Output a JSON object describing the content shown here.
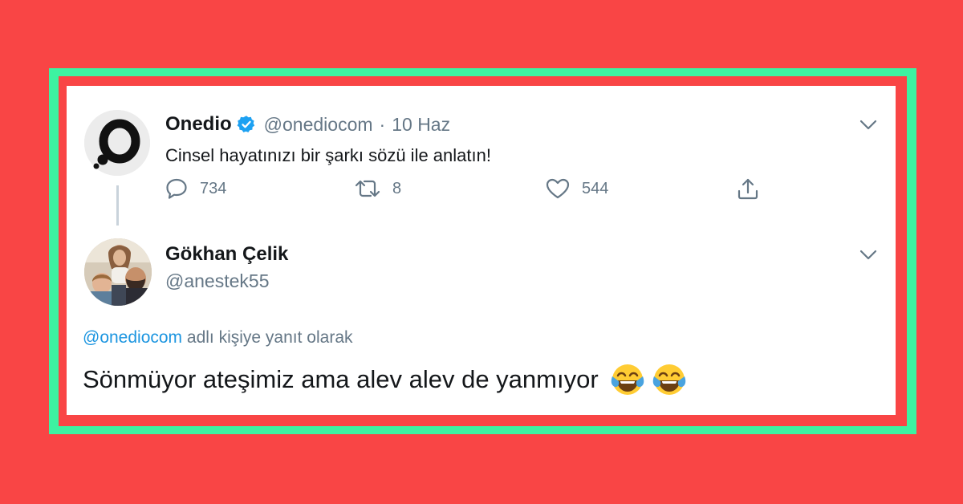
{
  "colors": {
    "background": "#f94545",
    "frame": "#3df2a1",
    "card": "#ffffff",
    "verified": "#1da1f2",
    "link": "#1b95e0",
    "muted": "#657786"
  },
  "original_tweet": {
    "display_name": "Onedio",
    "verified": true,
    "handle": "@onediocom",
    "separator": "·",
    "date": "10 Haz",
    "text": "Cinsel hayatınızı bir şarkı sözü ile anlatın!",
    "avatar_icon": "onedio-logo-icon",
    "actions": {
      "replies": "734",
      "retweets": "8",
      "likes": "544"
    }
  },
  "reply_tweet": {
    "display_name": "Gökhan Çelik",
    "handle": "@anestek55",
    "avatar_icon": "user-photo-avatar",
    "replying_to_handle": "@onediocom",
    "replying_to_suffix": " adlı kişiye yanıt olarak",
    "text": "Sönmüyor ateşimiz ama alev alev de yanmıyor",
    "emojis": [
      "face-with-tears-of-joy-icon",
      "face-with-tears-of-joy-icon"
    ]
  }
}
